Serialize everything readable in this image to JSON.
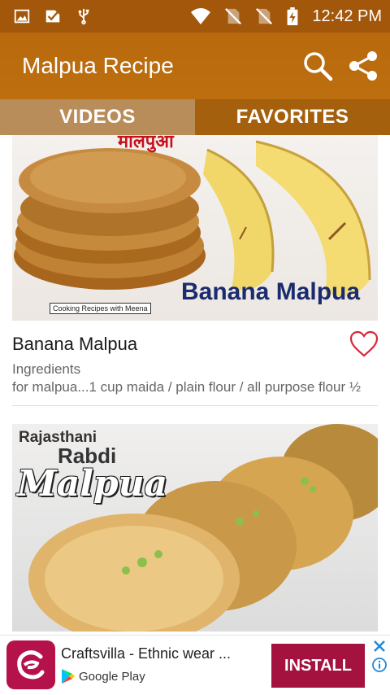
{
  "status_bar": {
    "time": "12:42 PM",
    "left_icons": [
      "image-icon",
      "check-ticket-icon",
      "usb-icon"
    ],
    "right_icons": [
      "wifi-icon",
      "no-sim-icon",
      "no-sim-icon",
      "battery-charging-icon"
    ]
  },
  "app_bar": {
    "title": "Malpua Recipe",
    "actions": [
      "search-icon",
      "share-icon"
    ]
  },
  "tabs": [
    {
      "label": "VIDEOS",
      "selected": true
    },
    {
      "label": "FAVORITES",
      "selected": false
    }
  ],
  "recipes": [
    {
      "title": "Banana Malpua",
      "subtitle": "Ingredients",
      "description": "for malpua...1 cup maida / plain flour / all purpose flour ½",
      "thumbnail_text": "Banana Malpua",
      "thumbnail_credit": "Cooking Recipes with Meena",
      "thumbnail_top_text": "मालपुआ",
      "favorite": false
    },
    {
      "thumbnail_line1": "Rajasthani",
      "thumbnail_line2": "Rabdi",
      "thumbnail_line3": "Malpua"
    }
  ],
  "ad": {
    "title": "Craftsvilla - Ethnic wear ...",
    "store": "Google Play",
    "button": "INSTALL",
    "colors": {
      "brand": "#b5124b",
      "button": "#a4123f"
    }
  },
  "colors": {
    "status_bar": "#a3570a",
    "app_bar": "#b8690c",
    "tab_selected": "#b98d59",
    "tab_unselected": "#a5600e",
    "heart": "#d9263a"
  }
}
